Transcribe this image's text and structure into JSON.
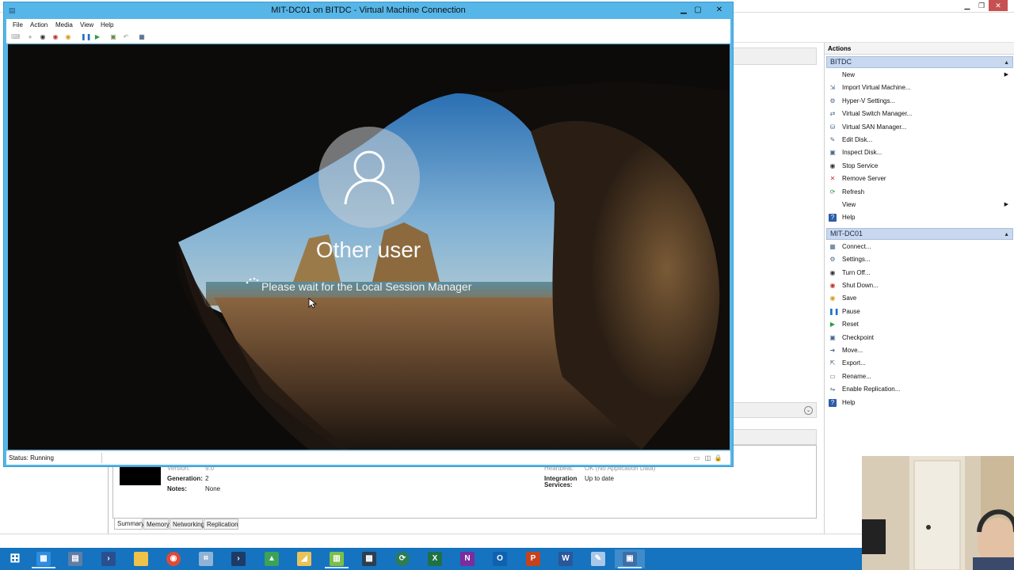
{
  "vm_connection": {
    "title": "MIT-DC01 on BITDC - Virtual Machine Connection",
    "menu": [
      "File",
      "Action",
      "Media",
      "View",
      "Help"
    ],
    "status": "Status: Running",
    "lock_screen": {
      "user": "Other user",
      "message": "Please wait for the Local Session Manager"
    }
  },
  "actions": {
    "title": "Actions",
    "groups": [
      {
        "header": "BITDC",
        "items": [
          {
            "label": "New",
            "icon": "blank",
            "submenu": true
          },
          {
            "label": "Import Virtual Machine...",
            "icon": "import-icon"
          },
          {
            "label": "Hyper-V Settings...",
            "icon": "settings-icon"
          },
          {
            "label": "Virtual Switch Manager...",
            "icon": "switch-icon"
          },
          {
            "label": "Virtual SAN Manager...",
            "icon": "san-icon"
          },
          {
            "label": "Edit Disk...",
            "icon": "edit-disk-icon"
          },
          {
            "label": "Inspect Disk...",
            "icon": "inspect-disk-icon"
          },
          {
            "label": "Stop Service",
            "icon": "stop-icon"
          },
          {
            "label": "Remove Server",
            "icon": "remove-icon"
          },
          {
            "label": "Refresh",
            "icon": "refresh-icon"
          },
          {
            "label": "View",
            "icon": "blank",
            "submenu": true
          },
          {
            "label": "Help",
            "icon": "help-icon"
          }
        ]
      },
      {
        "header": "MIT-DC01",
        "items": [
          {
            "label": "Connect...",
            "icon": "connect-icon"
          },
          {
            "label": "Settings...",
            "icon": "settings-icon"
          },
          {
            "label": "Turn Off...",
            "icon": "turn-off-icon"
          },
          {
            "label": "Shut Down...",
            "icon": "shutdown-icon"
          },
          {
            "label": "Save",
            "icon": "save-icon"
          },
          {
            "label": "Pause",
            "icon": "pause-icon"
          },
          {
            "label": "Reset",
            "icon": "reset-icon"
          },
          {
            "label": "Checkpoint",
            "icon": "checkpoint-icon"
          },
          {
            "label": "Move...",
            "icon": "move-icon"
          },
          {
            "label": "Export...",
            "icon": "export-icon"
          },
          {
            "label": "Rename...",
            "icon": "rename-icon"
          },
          {
            "label": "Enable Replication...",
            "icon": "replication-icon"
          },
          {
            "label": "Help",
            "icon": "help-icon"
          }
        ]
      }
    ]
  },
  "details": {
    "version_label": "Version:",
    "version_value": "9.0",
    "generation_label": "Generation:",
    "generation_value": "2",
    "notes_label": "Notes:",
    "notes_value": "None",
    "heartbeat_label": "Heartbeat:",
    "heartbeat_value": "OK (No Application Data)",
    "integration_label_1": "Integration",
    "integration_label_2": "Services:",
    "integration_value": "Up to date",
    "tabs": [
      "Summary",
      "Memory",
      "Networking",
      "Replication"
    ]
  },
  "taskbar": {
    "icons": [
      "start-icon",
      "hyper-v-manager-icon",
      "server-manager-icon",
      "powershell-icon",
      "file-explorer-icon",
      "chrome-icon",
      "network-icon",
      "powershell-ise-icon",
      "sheet-icon",
      "folder-icon",
      "notepad-icon",
      "qr-icon",
      "sync-icon",
      "excel-icon",
      "onenote-icon",
      "outlook-icon",
      "powerpoint-icon",
      "word-icon",
      "pen-icon",
      "vm-connection-icon"
    ]
  },
  "colors": {
    "window_border": "#56b6e8",
    "taskbar": "#1573bf",
    "action_group": "#c8d8ef",
    "close_button": "#c75050"
  }
}
